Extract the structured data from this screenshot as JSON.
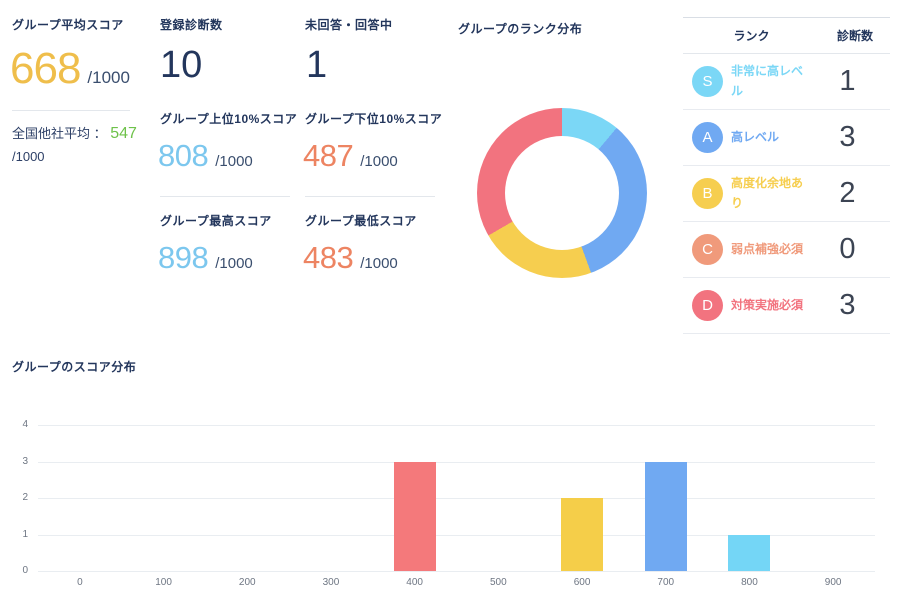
{
  "colors": {
    "heading_navy": "#23365c",
    "denominator_navy": "#3a4e6e",
    "gold": "#efbe4b",
    "green": "#6ec24a",
    "light_blue": "#7cc7ee",
    "salmon": "#ed8462",
    "count_dark": "#3c4453"
  },
  "metrics": {
    "group_avg": {
      "label": "グループ平均スコア",
      "value": "668",
      "denominator": "/1000"
    },
    "national_avg": {
      "label": "全国他社平均 ：",
      "value": "547",
      "denominator": "/1000"
    },
    "registered_count": {
      "label": "登録診断数",
      "value": "10"
    },
    "unanswered": {
      "label": "未回答・回答中",
      "value": "1"
    },
    "top10": {
      "label": "グループ上位10%スコア",
      "value": "808",
      "denominator": "/1000"
    },
    "bottom10": {
      "label": "グループ下位10%スコア",
      "value": "487",
      "denominator": "/1000"
    },
    "max": {
      "label": "グループ最高スコア",
      "value": "898",
      "denominator": "/1000"
    },
    "min": {
      "label": "グループ最低スコア",
      "value": "483",
      "denominator": "/1000"
    }
  },
  "rank_table": {
    "headers": [
      "ランク",
      "診断数"
    ],
    "rows": [
      {
        "rank": "S",
        "label": "非常に高レベル",
        "count": "1",
        "color": "#7bd7f6"
      },
      {
        "rank": "A",
        "label": "高レベル",
        "count": "3",
        "color": "#70a9f2"
      },
      {
        "rank": "B",
        "label": "高度化余地あり",
        "count": "2",
        "color": "#f6ce4f"
      },
      {
        "rank": "C",
        "label": "弱点補強必須",
        "count": "0",
        "color": "#f09a7b"
      },
      {
        "rank": "D",
        "label": "対策実施必須",
        "count": "3",
        "color": "#f2737f"
      }
    ]
  },
  "chart_data": [
    {
      "type": "pie",
      "subtype": "donut",
      "title": "グループのランク分布",
      "labels": [
        "S",
        "A",
        "B",
        "C",
        "D"
      ],
      "values": [
        1,
        3,
        2,
        0,
        3
      ],
      "colors": [
        "#7bd7f6",
        "#70a9f2",
        "#f6ce4f",
        "#f09a7b",
        "#f2737f"
      ],
      "start_angle_deg": 0,
      "direction": "clockwise"
    },
    {
      "type": "bar",
      "title": "グループのスコア分布",
      "x": [
        400,
        600,
        700,
        800
      ],
      "values": [
        3,
        2,
        3,
        1
      ],
      "bar_colors": [
        "#f4797b",
        "#f5ce49",
        "#70a9f2",
        "#74d6f6"
      ],
      "x_ticks": [
        0,
        100,
        200,
        300,
        400,
        500,
        600,
        700,
        800,
        900
      ],
      "x_range": [
        -50,
        950
      ],
      "ylim": [
        0,
        4
      ],
      "y_ticks": [
        0,
        1,
        2,
        3,
        4
      ],
      "grid": true,
      "xlabel": "",
      "ylabel": ""
    }
  ]
}
